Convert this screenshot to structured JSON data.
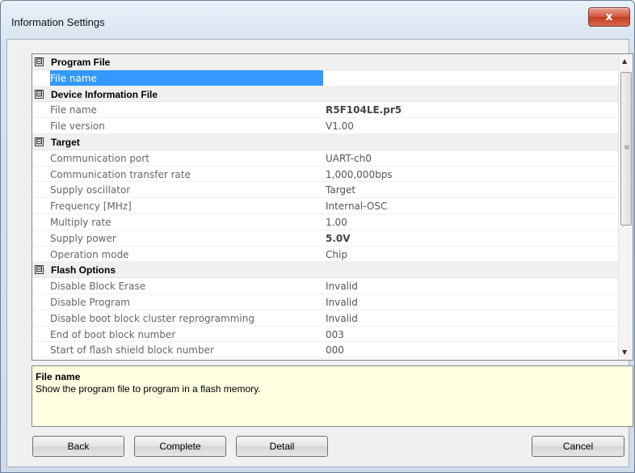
{
  "window": {
    "title": "Information Settings",
    "close_label": "x"
  },
  "grid": {
    "rows": [
      {
        "kind": "category",
        "label": "Program File"
      },
      {
        "kind": "property",
        "name": "File name",
        "value": "",
        "selected": true
      },
      {
        "kind": "category",
        "label": "Device Information File"
      },
      {
        "kind": "property",
        "name": "File name",
        "value": "R5F104LE.pr5",
        "bold": true
      },
      {
        "kind": "property",
        "name": "File version",
        "value": "V1.00"
      },
      {
        "kind": "category",
        "label": "Target"
      },
      {
        "kind": "property",
        "name": "Communication port",
        "value": "UART-ch0"
      },
      {
        "kind": "property",
        "name": "Communication transfer rate",
        "value": "1,000,000bps"
      },
      {
        "kind": "property",
        "name": "Supply oscillator",
        "value": "Target"
      },
      {
        "kind": "property",
        "name": "Frequency [MHz]",
        "value": "Internal-OSC"
      },
      {
        "kind": "property",
        "name": "Multiply rate",
        "value": "1.00"
      },
      {
        "kind": "property",
        "name": "Supply power",
        "value": "5.0V",
        "bold": true
      },
      {
        "kind": "property",
        "name": "Operation mode",
        "value": "Chip"
      },
      {
        "kind": "category",
        "label": "Flash Options"
      },
      {
        "kind": "property",
        "name": "Disable Block Erase",
        "value": "Invalid"
      },
      {
        "kind": "property",
        "name": "Disable Program",
        "value": "Invalid"
      },
      {
        "kind": "property",
        "name": "Disable boot block cluster reprogramming",
        "value": "Invalid"
      },
      {
        "kind": "property",
        "name": "End of boot block number",
        "value": "003"
      },
      {
        "kind": "property",
        "name": "Start of flash shield block number",
        "value": "000"
      }
    ],
    "collapse_glyph": "⊟",
    "scroll_up_icon": "up-arrow",
    "scroll_down_icon": "down-arrow"
  },
  "description": {
    "title": "File name",
    "text": "Show the program file to program in a flash memory."
  },
  "buttons": {
    "back": "Back",
    "complete": "Complete",
    "detail": "Detail",
    "cancel": "Cancel"
  },
  "colors": {
    "selection": "#3399ff",
    "description_bg": "#ffffe1",
    "close_button": "#c33d24"
  }
}
